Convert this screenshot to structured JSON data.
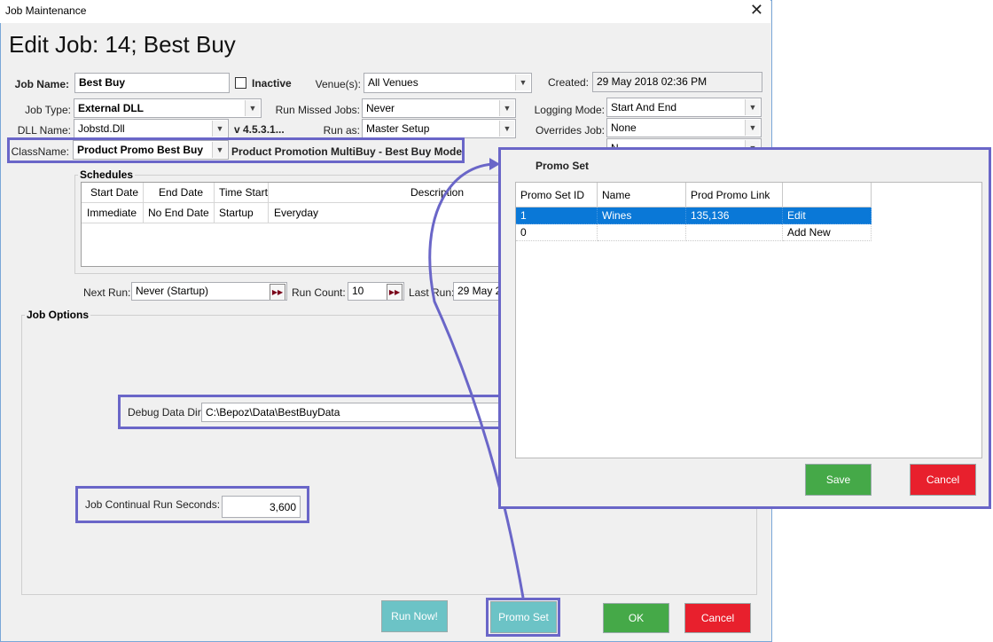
{
  "window": {
    "title": "Job Maintenance",
    "close_glyph": "✕"
  },
  "heading": "Edit Job: 14; Best Buy",
  "form": {
    "job_name_label": "Job Name:",
    "job_name_value": "Best Buy",
    "inactive_label": "Inactive",
    "venues_label": "Venue(s):",
    "venues_value": "All Venues",
    "created_label": "Created:",
    "created_value": "29 May 2018 02:36 PM",
    "job_type_label": "Job Type:",
    "job_type_value": "External DLL",
    "run_missed_label": "Run Missed Jobs:",
    "run_missed_value": "Never",
    "logging_label": "Logging Mode:",
    "logging_value": "Start And End",
    "dll_label": "DLL Name:",
    "dll_value": "Jobstd.Dll",
    "dll_version": "v 4.5.3.1...",
    "run_as_label": "Run as:",
    "run_as_value": "Master Setup",
    "overrides_label": "Overrides Job:",
    "overrides_value": "None",
    "extra_value": "N",
    "classname_label": "ClassName:",
    "classname_value": "Product Promo Best Buy",
    "classname_desc": "Product Promotion MultiBuy - Best Buy Mode"
  },
  "schedules": {
    "label": "Schedules",
    "columns": [
      "Start Date",
      "End Date",
      "Time Start",
      "Description"
    ],
    "rows": [
      [
        "Immediate",
        "No End Date",
        "Startup",
        "Everyday"
      ]
    ]
  },
  "run_info": {
    "next_run_label": "Next Run:",
    "next_run_value": "Never (Startup)",
    "run_count_label": "Run Count:",
    "run_count_value": "10",
    "last_run_label": "Last Run:",
    "last_run_value": "29 May 2"
  },
  "job_options": {
    "label": "Job Options",
    "debug_dir_label": "Debug Data Dir",
    "debug_dir_value": "C:\\Bepoz\\Data\\BestBuyData",
    "continual_label": "Job Continual Run Seconds:",
    "continual_value": "3,600"
  },
  "buttons": {
    "run_now": "Run Now!",
    "promo_set": "Promo Set",
    "ok": "OK",
    "cancel": "Cancel"
  },
  "promo_set": {
    "title": "Promo Set",
    "columns": [
      "Promo Set ID",
      "Name",
      "Prod Promo Link",
      ""
    ],
    "rows": [
      {
        "id": "1",
        "name": "Wines",
        "link": "135,136",
        "action": "Edit",
        "selected": true
      },
      {
        "id": "0",
        "name": "",
        "link": "",
        "action": "Add New",
        "selected": false
      }
    ],
    "save": "Save",
    "cancel": "Cancel"
  },
  "colors": {
    "highlight": "#6a66c8",
    "teal_button": "#6cc3c6",
    "green_button": "#45a948",
    "red_button": "#e8202d",
    "selected_row": "#0a78d7"
  }
}
